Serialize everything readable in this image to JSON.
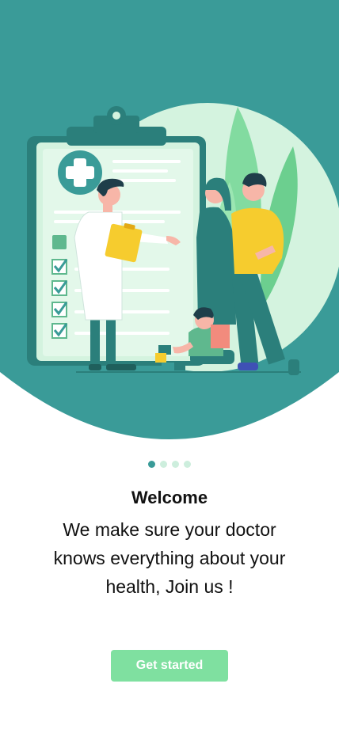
{
  "onboarding": {
    "title": "Welcome",
    "description": "We make sure your doctor knows everything about your health, Join us !",
    "button_label": "Get started",
    "pager": {
      "total": 4,
      "current": 1
    }
  },
  "colors": {
    "teal": "#3a9b98",
    "mint": "#cdeedd",
    "button": "#7fe0a0",
    "yellow": "#f6cc2e"
  },
  "illustration": {
    "icons": [
      "clipboard-icon",
      "medical-cross-icon",
      "doctor-figure",
      "family-figures",
      "checkmark-icon"
    ]
  }
}
